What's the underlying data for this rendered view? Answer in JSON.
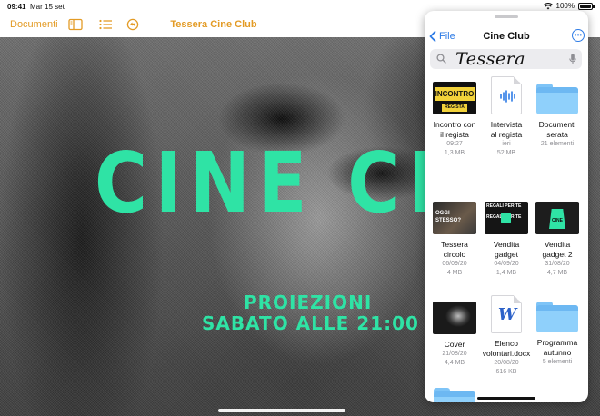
{
  "status": {
    "time": "09:41",
    "date": "Mar 15 set",
    "battery": "100%"
  },
  "toolbar": {
    "documents_label": "Documenti",
    "title": "Tessera Cine Club"
  },
  "poster": {
    "title": "CINE CLU",
    "line1": "PROIEZIONI",
    "line2": "SABATO ALLE 21:00"
  },
  "files_panel": {
    "back_label": "File",
    "title": "Cine Club",
    "search_value": "Tessera",
    "items": [
      {
        "name1": "Incontro con",
        "name2": "il regista",
        "date": "09:27",
        "size": "1,3 MB",
        "thumb_text1": "INCONTRO",
        "thumb_text2": "REGISTA"
      },
      {
        "name1": "Intervista",
        "name2": "al regista",
        "date": "ieri",
        "size": "52 MB"
      },
      {
        "name1": "Documenti",
        "name2": "serata",
        "date": "",
        "size": "21 elementi"
      },
      {
        "name1": "Tessera",
        "name2": "circolo",
        "date": "06/09/20",
        "size": "4 MB",
        "thumb_text1": "OGGI",
        "thumb_text2": "STESSO?"
      },
      {
        "name1": "Vendita",
        "name2": "gadget",
        "date": "04/09/20",
        "size": "1,4 MB",
        "thumb_text1": "REGALI PER TE",
        "thumb_text2": "REGALI PER TE"
      },
      {
        "name1": "Vendita",
        "name2": "gadget 2",
        "date": "31/08/20",
        "size": "4,7 MB",
        "thumb_text1": "CINE"
      },
      {
        "name1": "Cover",
        "name2": "",
        "date": "21/08/20",
        "size": "4,4 MB"
      },
      {
        "name1": "Elenco",
        "name2": "volontari.docx",
        "date": "20/08/20",
        "size": "616 KB",
        "thumb_text1": "W"
      },
      {
        "name1": "Programma",
        "name2": "autunno",
        "date": "",
        "size": "5 elementi"
      }
    ]
  },
  "colors": {
    "accent_orange": "#e39b25",
    "accent_blue": "#2d7be6",
    "poster_green": "#2fe3a5",
    "folder_blue": "#8fd0fb"
  }
}
